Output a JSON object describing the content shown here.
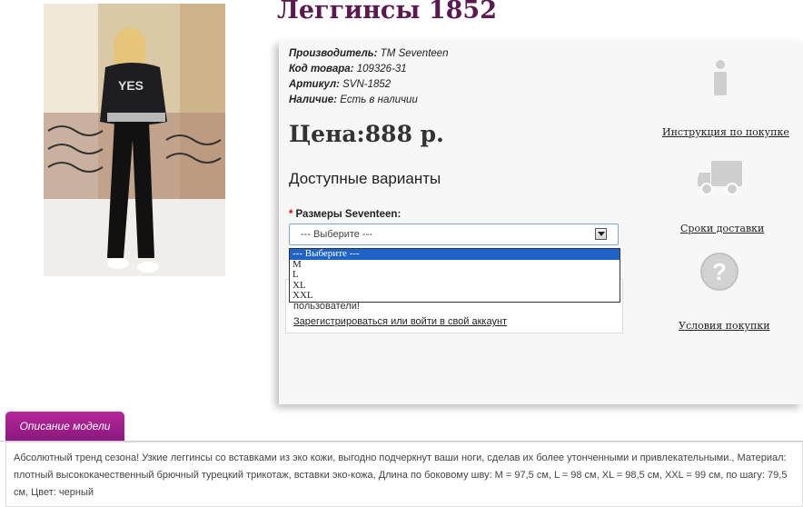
{
  "product": {
    "title": "Леггинсы 1852",
    "manufacturer_label": "Производитель:",
    "manufacturer_value": "ТМ Seventeen",
    "code_label": "Код товара:",
    "code_value": "109326-31",
    "article_label": "Артикул:",
    "article_value": "SVN-1852",
    "availability_label": "Наличие:",
    "availability_value": "Есть в наличии",
    "price": "Цена:888 р."
  },
  "options": {
    "heading": "Доступные варианты",
    "required_mark": "*",
    "size_label": "Размеры Seventeen:",
    "selected_value": "--- Выберите ---",
    "choices": [
      "--- Выберите ---",
      "M",
      "L",
      "XL",
      "XXL"
    ]
  },
  "login_notice": {
    "text": "пользователи!",
    "link": "Зарегистрироваться или войти в свой аккаунт"
  },
  "side_links": {
    "instruction": "Инструкция по покупке",
    "delivery": "Сроки доставки",
    "terms": "Условия покупки"
  },
  "description": {
    "tab": "Описание модели",
    "text": "Абсолютный тренд сезона! Узкие леггинсы со вставками из эко кожи, выгодно подчеркнут ваши ноги, сделав их более утонченными и привлекательными., Материал: плотный высококачественный брючный турецкий трикотаж, вставки эко-кожа, Длина по боковому шву: M = 97,5 см, L = 98 см, XL = 98,5 см, XXL = 99 см, по шагу: 79,5 см, Цвет: черный"
  },
  "colors": {
    "title": "#5a1a4f",
    "tab": "#9c1c8c",
    "selection": "#1e64c8"
  }
}
